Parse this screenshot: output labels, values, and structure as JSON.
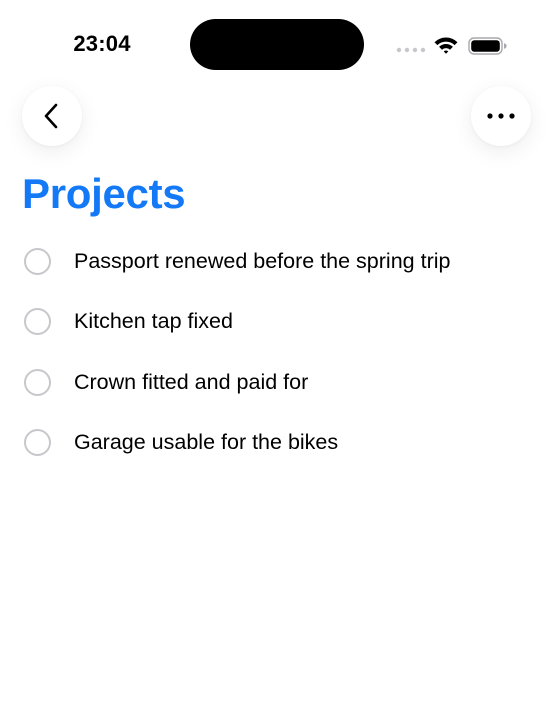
{
  "status_bar": {
    "time": "23:04",
    "signal_icon": "cellular-signal-icon",
    "wifi_icon": "wifi-icon",
    "battery_icon": "battery-icon"
  },
  "nav": {
    "back_icon": "chevron-left-icon",
    "more_icon": "ellipsis-icon"
  },
  "page": {
    "title": "Projects",
    "accent_color": "#1479F7"
  },
  "tasks": [
    {
      "label": "Passport renewed before the spring trip",
      "completed": false
    },
    {
      "label": "Kitchen tap fixed",
      "completed": false
    },
    {
      "label": "Crown fitted and paid for",
      "completed": false
    },
    {
      "label": "Garage usable for the bikes",
      "completed": false
    }
  ]
}
